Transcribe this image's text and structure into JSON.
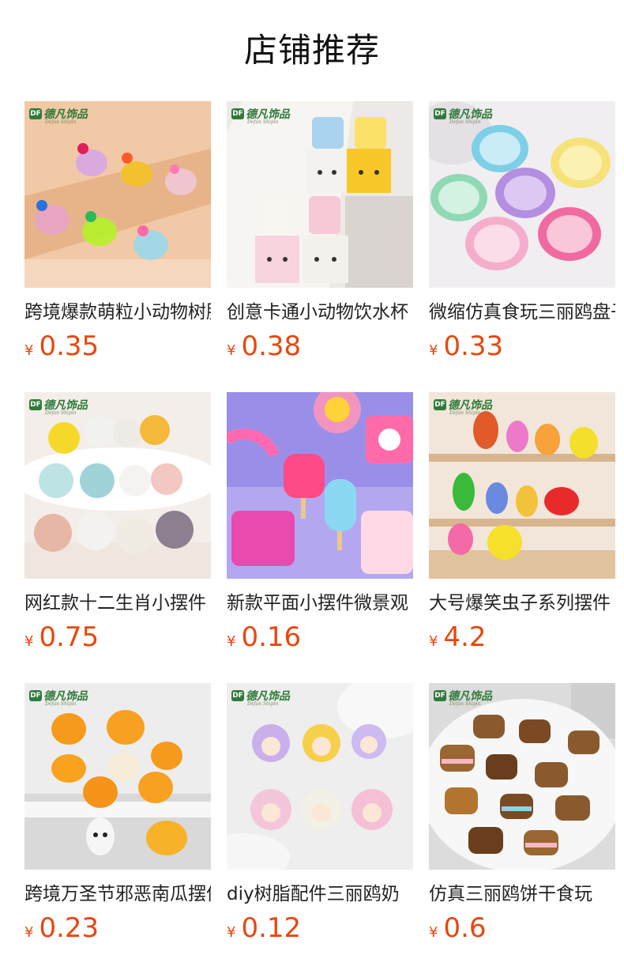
{
  "page": {
    "title": "店铺推荐"
  },
  "brand": {
    "logo": "DF",
    "name": "德凡饰品",
    "sub": "Defan Shipin"
  },
  "currency": "¥",
  "colors": {
    "price": "#e8470f",
    "brand": "#2f7a3a"
  },
  "products": [
    {
      "name": "跨境爆款萌粒小动物树脂摆件",
      "price": "0.35"
    },
    {
      "name": "创意卡通小动物饮水杯",
      "price": "0.38"
    },
    {
      "name": "微缩仿真食玩三丽鸥盘子",
      "price": "0.33"
    },
    {
      "name": "网红款十二生肖小摆件",
      "price": "0.75"
    },
    {
      "name": "新款平面小摆件微景观",
      "price": "0.16"
    },
    {
      "name": "大号爆笑虫子系列摆件",
      "price": "4.2"
    },
    {
      "name": "跨境万圣节邪恶南瓜摆件",
      "price": "0.23"
    },
    {
      "name": "diy树脂配件三丽鸥奶",
      "price": "0.12"
    },
    {
      "name": "仿真三丽鸥饼干食玩",
      "price": "0.6"
    }
  ]
}
